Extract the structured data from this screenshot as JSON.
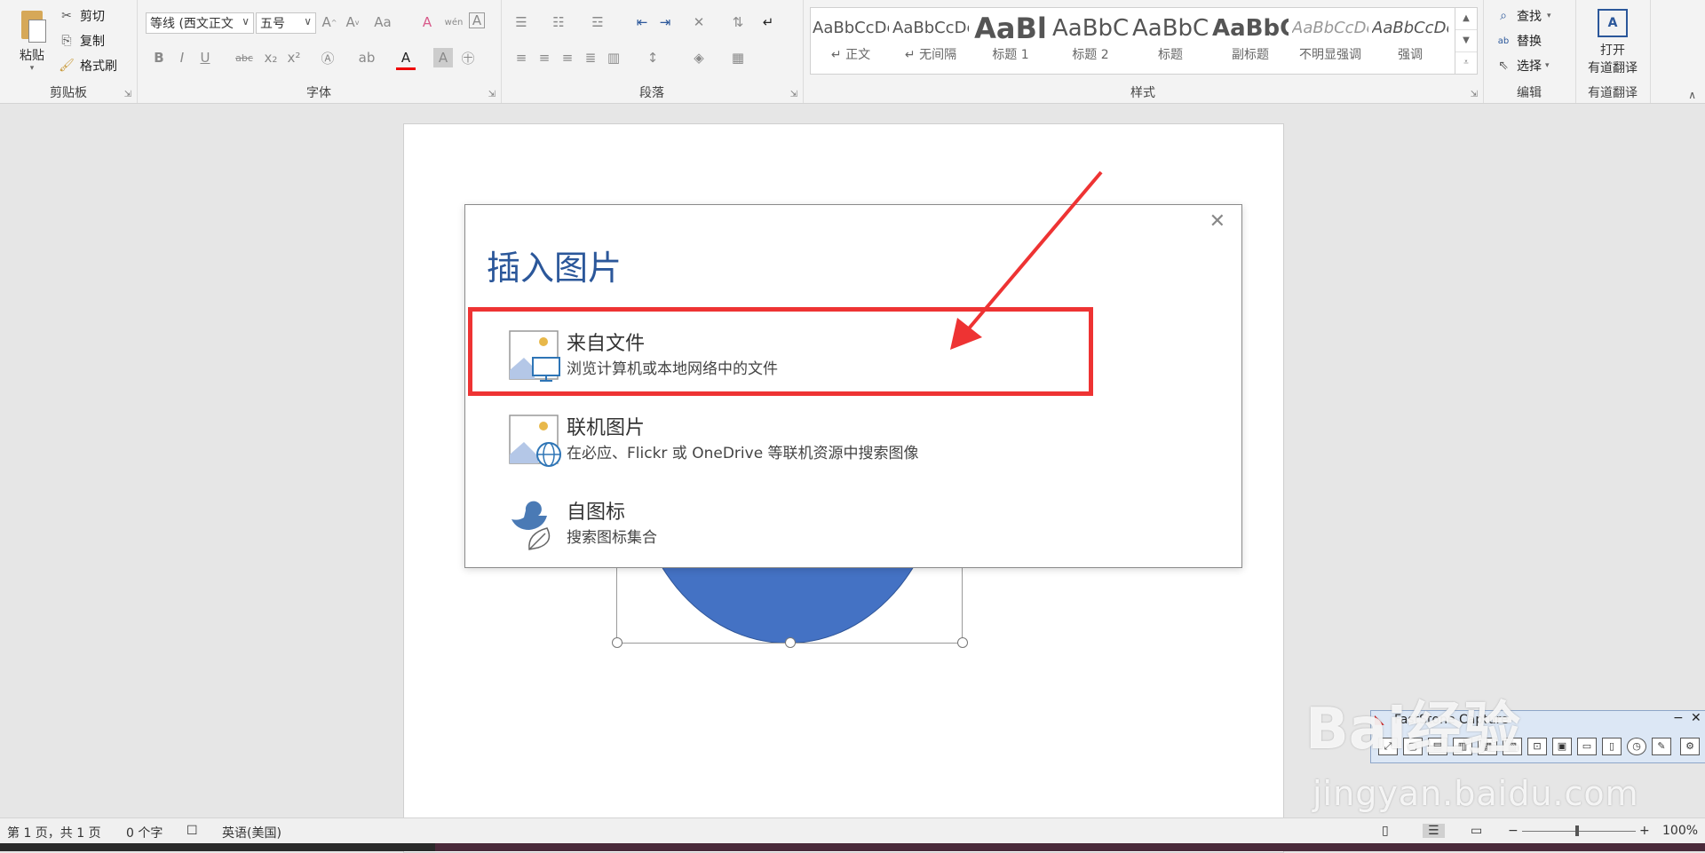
{
  "ribbon": {
    "clipboard": {
      "paste_label": "粘贴",
      "cut_label": "剪切",
      "copy_label": "复制",
      "format_painter_label": "格式刷",
      "group_label": "剪贴板"
    },
    "font": {
      "font_name": "等线 (西文正文",
      "font_size": "五号",
      "group_label": "字体"
    },
    "paragraph": {
      "group_label": "段落"
    },
    "styles": {
      "group_label": "样式",
      "items": [
        {
          "preview": "AaBbCcDc",
          "name": "↵ 正文"
        },
        {
          "preview": "AaBbCcDc",
          "name": "↵ 无间隔"
        },
        {
          "preview": "AaBl",
          "name": "标题 1"
        },
        {
          "preview": "AaBbC",
          "name": "标题 2"
        },
        {
          "preview": "AaBbC",
          "name": "标题"
        },
        {
          "preview": "AaBbC",
          "name": "副标题"
        },
        {
          "preview": "AaBbCcDc",
          "name": "不明显强调"
        },
        {
          "preview": "AaBbCcDc",
          "name": "强调"
        }
      ]
    },
    "editing": {
      "find_label": "查找",
      "replace_label": "替换",
      "select_label": "选择",
      "group_label": "编辑"
    },
    "youdao": {
      "open_label_1": "打开",
      "open_label_2": "有道翻译",
      "group_label": "有道翻译"
    }
  },
  "dialog": {
    "title": "插入图片",
    "options": [
      {
        "title": "来自文件",
        "desc": "浏览计算机或本地网络中的文件"
      },
      {
        "title": "联机图片",
        "desc": "在必应、Flickr 或 OneDrive 等联机资源中搜索图像"
      },
      {
        "title": "自图标",
        "desc": "搜索图标集合"
      }
    ],
    "highlight_color": "#ee3333"
  },
  "statusbar": {
    "page_info": "第 1 页，共 1 页",
    "word_count": "0 个字",
    "language": "英语(美国)",
    "zoom": "100%"
  },
  "faststone": {
    "title": "FastStone Capture"
  },
  "watermark": {
    "text": "Bai经验",
    "sub": "jingyan.baidu.com"
  },
  "colors": {
    "accent": "#2b579a",
    "shape_fill": "#4472c4",
    "arrow": "#ee3333"
  }
}
